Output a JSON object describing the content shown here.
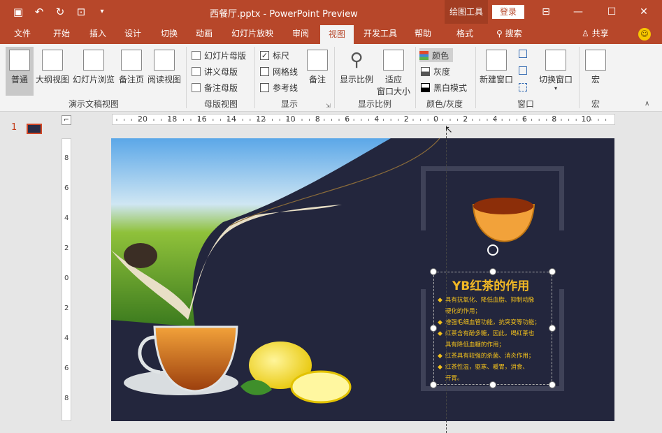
{
  "titlebar": {
    "title": "西餐厅.pptx - PowerPoint Preview",
    "context_tab": "绘图工具",
    "login": "登录"
  },
  "tabs": [
    "文件",
    "开始",
    "插入",
    "设计",
    "切换",
    "动画",
    "幻灯片放映",
    "审阅",
    "视图",
    "开发工具",
    "帮助",
    "格式"
  ],
  "search": "搜索",
  "share": "共享",
  "ribbon": {
    "presentation_views": {
      "normal": "普通",
      "outline": "大纲视图",
      "sorter": "幻灯片浏览",
      "notes_page": "备注页",
      "reading": "阅读视图",
      "label": "演示文稿视图"
    },
    "master_views": {
      "slide_master": "幻灯片母版",
      "handout_master": "讲义母版",
      "notes_master": "备注母版",
      "label": "母版视图"
    },
    "show": {
      "ruler": "标尺",
      "gridlines": "网格线",
      "guides": "参考线",
      "notes": "备注",
      "label": "显示"
    },
    "zoom": {
      "zoom": "显示比例",
      "fit_line1": "适应",
      "fit_line2": "窗口大小",
      "label": "显示比例"
    },
    "color": {
      "color": "颜色",
      "grayscale": "灰度",
      "bw": "黑白模式",
      "label": "颜色/灰度"
    },
    "window": {
      "new_window": "新建窗口",
      "switch_windows": "切换窗口",
      "label": "窗口"
    },
    "macros": {
      "macros": "宏",
      "label": "宏"
    }
  },
  "slide_number": "1",
  "hruler_labels": [
    "20",
    "18",
    "16",
    "14",
    "12",
    "10",
    "8",
    "6",
    "4",
    "2",
    "0",
    "2",
    "4",
    "6",
    "8",
    "10"
  ],
  "vruler_labels": [
    "8",
    "6",
    "4",
    "2",
    "0",
    "2",
    "4",
    "6",
    "8"
  ],
  "slide": {
    "title": "YB红茶的作用",
    "bullets": [
      [
        "具有抗氧化、降低血脂、抑制动脉",
        "硬化的作用；"
      ],
      [
        "增强毛细血管功能，抗突变等功能；"
      ],
      [
        "红茶含有酚多糖，因此，喝红茶也",
        "具有降低血糖的作用；"
      ],
      [
        "红茶具有较强的杀菌、消炎作用；"
      ],
      [
        "红茶性温，驱寒、暖胃，消食、",
        "开胃。"
      ]
    ]
  }
}
